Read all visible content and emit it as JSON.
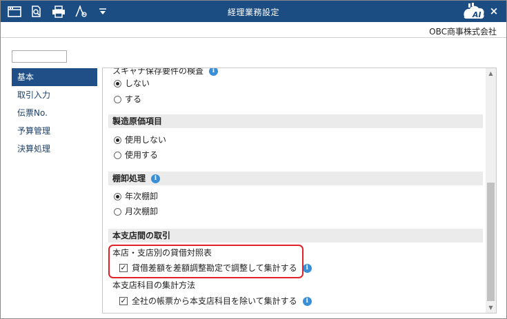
{
  "window": {
    "title": "経理業務設定",
    "company": "OBC商事株式会社",
    "toolbar_icons": [
      "window-icon",
      "preview-search-icon",
      "print-icon",
      "pdf-export-icon",
      "dropdown-arrow-icon"
    ],
    "logo_text": "AI",
    "close_label": "×"
  },
  "sidebar": {
    "search_value": "",
    "items": [
      {
        "label": "基本",
        "active": true
      },
      {
        "label": "取引入力",
        "active": false
      },
      {
        "label": "伝票No.",
        "active": false
      },
      {
        "label": "予算管理",
        "active": false
      },
      {
        "label": "決算処理",
        "active": false
      }
    ]
  },
  "content": {
    "scanner_section": {
      "title": "スキャナ保存要件の検査",
      "options": [
        {
          "label": "しない",
          "selected": true
        },
        {
          "label": "する",
          "selected": false
        }
      ]
    },
    "manufacturing_cost": {
      "title": "製造原価項目",
      "options": [
        {
          "label": "使用しない",
          "selected": true
        },
        {
          "label": "使用する",
          "selected": false
        }
      ]
    },
    "inventory": {
      "title": "棚卸処理",
      "options": [
        {
          "label": "年次棚卸",
          "selected": true
        },
        {
          "label": "月次棚卸",
          "selected": false
        }
      ]
    },
    "branch": {
      "title": "本支店間の取引",
      "balance_sheet_label": "本店・支店別の貸借対照表",
      "balance_checkbox_label": "貸借差額を差額調整勘定で調整して集計する",
      "balance_checked": true,
      "aggregation_label": "本支店科目の集計方法",
      "aggregation_checkbox_label": "全社の帳票から本支店科目を除いて集計する",
      "aggregation_checked": true
    }
  },
  "colors": {
    "titlebar": "#1c4d82",
    "active_item": "#1f4f86",
    "info_icon": "#3a8fd6",
    "highlight": "#e0212a"
  },
  "icons": {
    "info": "i",
    "check": "✓",
    "scroll_up": "▲",
    "scroll_down": "▼"
  }
}
